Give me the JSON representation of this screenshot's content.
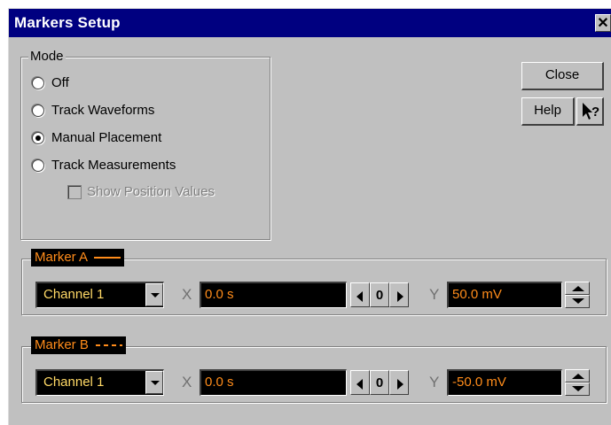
{
  "window": {
    "title": "Markers Setup",
    "close_glyph": "✕"
  },
  "mode": {
    "label": "Mode",
    "options": [
      {
        "label": "Off",
        "selected": false
      },
      {
        "label": "Track Waveforms",
        "selected": false
      },
      {
        "label": "Manual Placement",
        "selected": true
      },
      {
        "label": "Track Measurements",
        "selected": false
      }
    ],
    "show_position_values": {
      "label": "Show Position Values",
      "checked": false,
      "enabled": false
    }
  },
  "buttons": {
    "close": "Close",
    "help": "Help",
    "context_help_icon": "pointer-question-icon"
  },
  "marker_a": {
    "title": "Marker A",
    "line_style": "solid",
    "channel": "Channel 1",
    "x_label": "X",
    "x_value": "0.0 s",
    "nudge_center": "0",
    "y_label": "Y",
    "y_value": "50.0 mV"
  },
  "marker_b": {
    "title": "Marker B",
    "line_style": "dashed",
    "channel": "Channel 1",
    "x_label": "X",
    "x_value": "0.0 s",
    "nudge_center": "0",
    "y_label": "Y",
    "y_value": "-50.0 mV"
  },
  "colors": {
    "titlebar": "#000080",
    "dialog_bg": "#c0c0c0",
    "field_bg": "#000000",
    "value_text": "#ff8c1a",
    "channel_text": "#ffd966"
  }
}
